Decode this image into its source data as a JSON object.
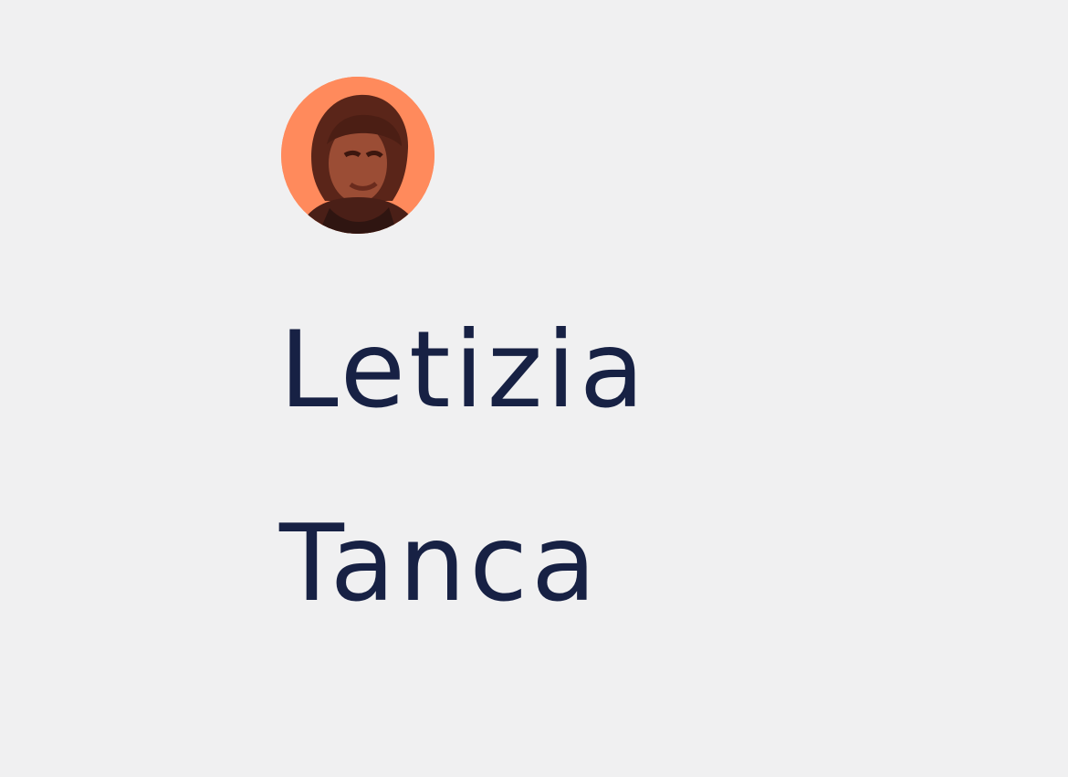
{
  "profile": {
    "avatar_icon": "person-avatar-icon",
    "first_name": "Letizia",
    "last_name": "Tanca"
  },
  "colors": {
    "background": "#f0f0f1",
    "avatar_background": "#ff8a5c",
    "name_text": "#172144"
  }
}
